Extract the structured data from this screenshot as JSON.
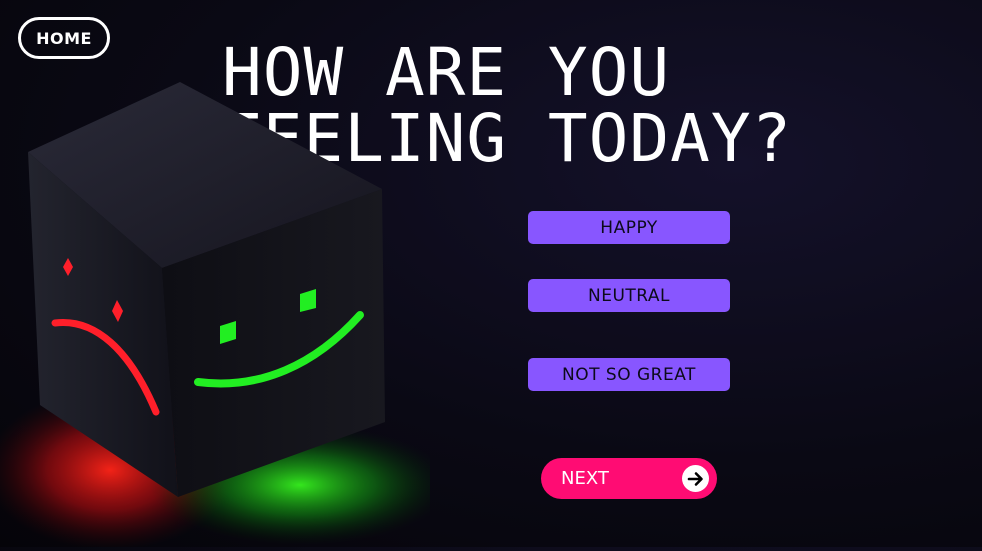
{
  "nav": {
    "home_label": "HOME"
  },
  "headline": "HOW ARE YOU\nFEELING TODAY?",
  "options": [
    {
      "label": "HAPPY"
    },
    {
      "label": "NEUTRAL"
    },
    {
      "label": "NOT SO GREAT"
    }
  ],
  "next": {
    "label": "NEXT",
    "icon": "arrow-right-icon"
  },
  "illustration": {
    "icon": "mood-cube-icon",
    "faces": [
      "sad-face",
      "smiley-face"
    ]
  },
  "colors": {
    "background": "#0a0914",
    "option_bg": "#8856ff",
    "next_bg": "#ff0c73",
    "sad_red": "#ff1f2a",
    "happy_green": "#22ee22"
  }
}
